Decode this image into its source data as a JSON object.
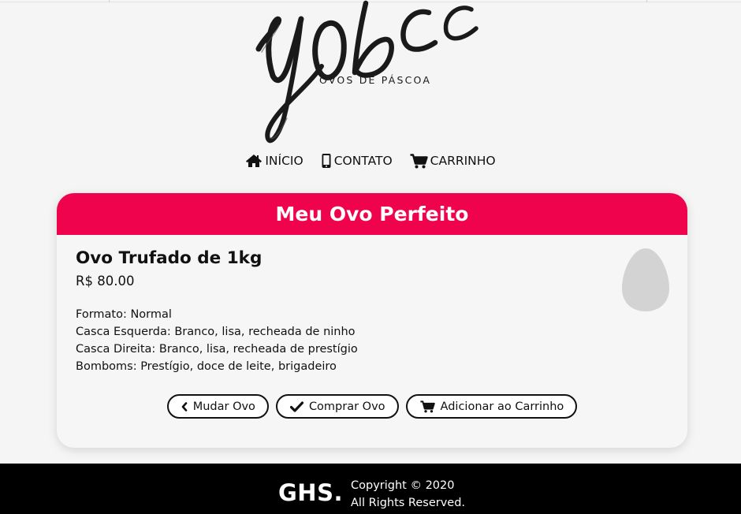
{
  "brand": {
    "logo_text": "Yobc",
    "tagline": "OVOS DE PÁSCOA"
  },
  "nav": {
    "items": [
      {
        "icon": "home-icon",
        "label": "INÍCIO"
      },
      {
        "icon": "smartphone-icon",
        "label": "CONTATO"
      },
      {
        "icon": "cart-icon",
        "label": "CARRINHO"
      }
    ]
  },
  "card": {
    "title": "Meu Ovo Perfeito",
    "product_name": "Ovo Trufado de 1kg",
    "price": "R$ 80.00",
    "specs": [
      "Formato: Normal",
      "Casca Esquerda: Branco, lisa, recheada de ninho",
      "Casca Direita: Branco, lisa, recheada de prestígio",
      "Bomboms: Prestígio, doce de leite, brigadeiro"
    ],
    "buttons": {
      "change": "Mudar Ovo",
      "buy": "Comprar Ovo",
      "add_cart": "Adicionar ao Carrinho"
    }
  },
  "footer": {
    "logo": "GHS.",
    "copyright": "Copyright © 2020",
    "rights": "All Rights Reserved."
  },
  "colors": {
    "accent": "#f0034d",
    "background": "#f5f5f5",
    "footer": "#000000",
    "egg": "#d3d3d3"
  }
}
